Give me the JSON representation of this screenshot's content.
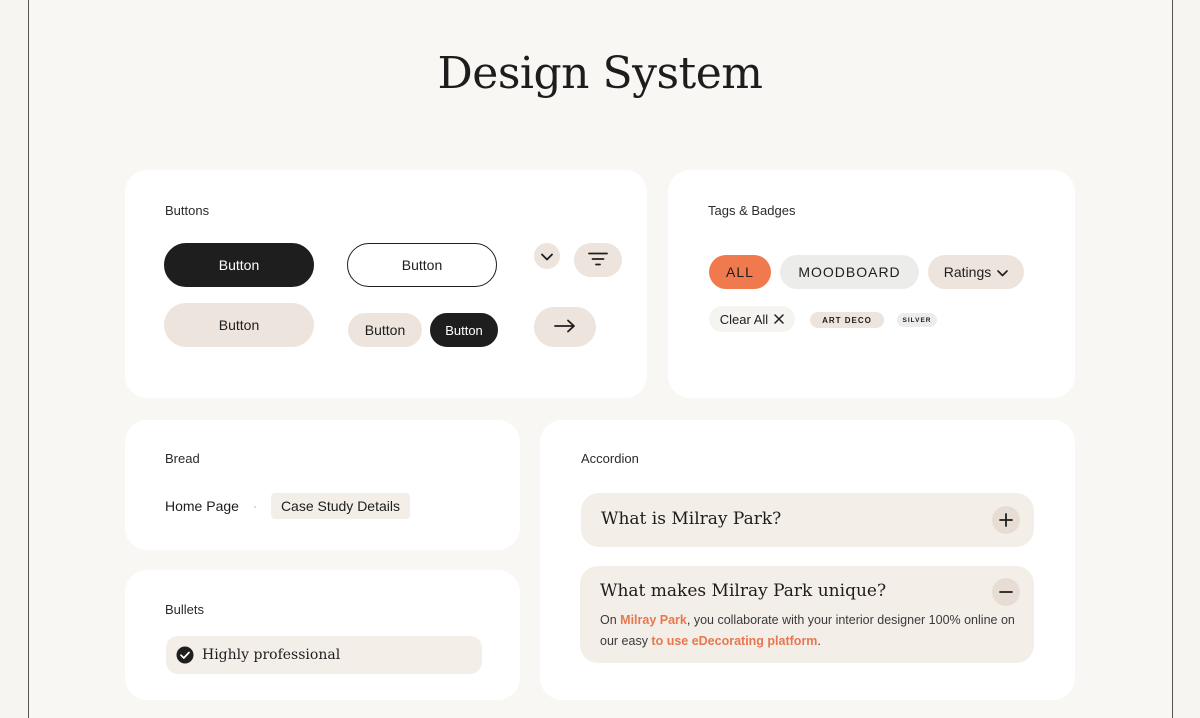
{
  "page": {
    "title": "Design System"
  },
  "buttons_card": {
    "label": "Buttons",
    "primary_dark": "Button",
    "primary_outline": "Button",
    "primary_soft": "Button",
    "small_soft": "Button",
    "small_dark": "Button"
  },
  "tags_card": {
    "label": "Tags & Badges",
    "all": "ALL",
    "moodboard": "MOODBOARD",
    "ratings": "Ratings",
    "clear_all": "Clear All",
    "art_deco": "ART DECO",
    "silver": "SILVER"
  },
  "bread_card": {
    "label": "Bread",
    "home": "Home Page",
    "separator": "·",
    "current": "Case Study Details"
  },
  "bullets_card": {
    "label": "Bullets",
    "item": "Highly professional"
  },
  "accordion_card": {
    "label": "Accordion",
    "items": [
      {
        "question": "What is Milray Park?"
      },
      {
        "question": "What makes Milray Park unique?",
        "answer_pre": "On ",
        "answer_link1": "Milray Park",
        "answer_mid": ", you collaborate with your interior designer 100% online on our easy ",
        "answer_link2": "to use eDecorating platform",
        "answer_post": "."
      }
    ]
  },
  "colors": {
    "accent": "#f07a4d",
    "dark": "#1e1e1e",
    "soft": "#ece4dd",
    "background": "#f8f7f3"
  }
}
